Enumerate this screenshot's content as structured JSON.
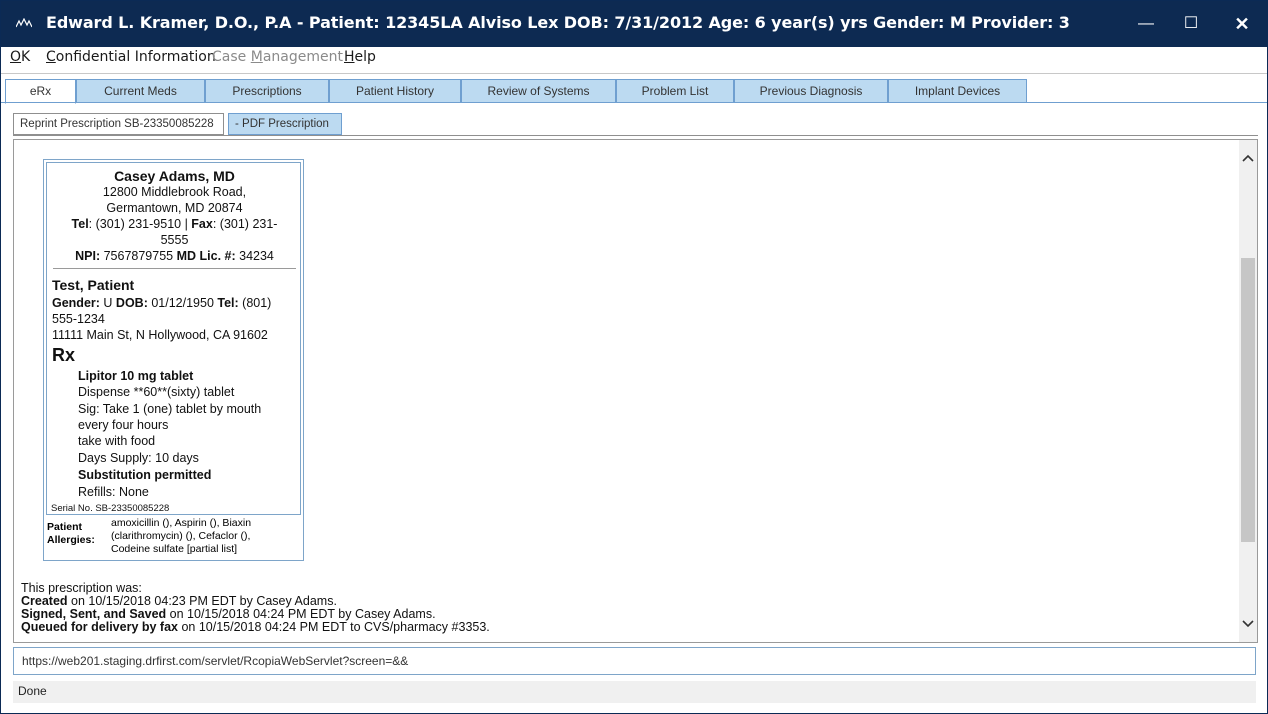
{
  "window": {
    "title": "Edward L. Kramer, D.O., P.A - Patient: 12345LA Alviso  Lex DOB: 7/31/2012 Age: 6 year(s) yrs Gender: M Provider: 3",
    "minimize_symbol": "—",
    "maximize_symbol": "☐",
    "close_symbol": "✕"
  },
  "menu": {
    "ok": {
      "u": "O",
      "rest": "K"
    },
    "confidential": {
      "u": "C",
      "rest": "onfidential Information"
    },
    "case_pre": "Case ",
    "case_u": "M",
    "case_post": "anagement",
    "help": {
      "u": "H",
      "rest": "elp"
    }
  },
  "tabs": [
    "eRx",
    "Current Meds",
    "Prescriptions",
    "Patient History",
    "Review of Systems",
    "Problem List",
    "Previous Diagnosis",
    "Implant Devices"
  ],
  "subtabs": {
    "reprint": "Reprint Prescription SB-23350085228",
    "pdf": " - PDF Prescription"
  },
  "prescription": {
    "doctor_name": "Casey Adams, MD",
    "address_line1": "12800 Middlebrook Road,",
    "address_line2": "Germantown, MD 20874",
    "tel_label": "Tel",
    "tel_value": ": (301) 231-9510  | ",
    "fax_label": "Fax",
    "fax_value": ": (301) 231-",
    "fax_value2": "5555",
    "npi_label": "NPI:",
    "npi_value": " 7567879755 ",
    "lic_label": "MD Lic. #:",
    "lic_value": " 34234",
    "patient_name": "Test, Patient",
    "gender_label": "Gender:",
    "gender_value": " U  ",
    "dob_label": "DOB:",
    "dob_value": " 01/12/1950  ",
    "ptel_label": "Tel:",
    "ptel_value": " (801)",
    "ptel_value2": "555-1234",
    "patient_address": "11111 Main St,  N Hollywood, CA 91602",
    "rx_symbol": "Rx",
    "drug": "Lipitor 10 mg tablet",
    "dispense": "Dispense **60**(sixty) tablet",
    "sig_line1": "Sig: Take 1 (one) tablet by mouth",
    "sig_line2": "every four hours",
    "sig_line3": "take with food",
    "days_supply": "Days Supply: 10 days",
    "substitution": "Substitution permitted",
    "refills": "Refills: None",
    "serial": "Serial No. SB-23350085228",
    "allergy_label_1": "Patient",
    "allergy_label_2": "Allergies:",
    "allergy_line1": "amoxicillin (), Aspirin (), Biaxin",
    "allergy_line2": "(clarithromycin) (), Cefaclor (),",
    "allergy_line3": "Codeine sulfate [partial list]"
  },
  "status": {
    "intro": "This prescription was:",
    "created_bold": "Created",
    "created_rest": " on 10/15/2018 04:23 PM EDT by Casey Adams.",
    "signed_bold": "Signed, Sent, and Saved",
    "signed_rest": " on 10/15/2018 04:24 PM EDT by Casey Adams.",
    "queued_bold": "Queued for delivery by fax",
    "queued_rest": " on 10/15/2018 04:24 PM EDT to CVS/pharmacy #3353."
  },
  "url": "https://web201.staging.drfirst.com/servlet/RcopiaWebServlet?screen=&&",
  "status_bar": "Done",
  "colors": {
    "titlebar": "#0d2a52",
    "tab_bg": "#bcdaf1",
    "tab_border": "#6f9fd0"
  }
}
